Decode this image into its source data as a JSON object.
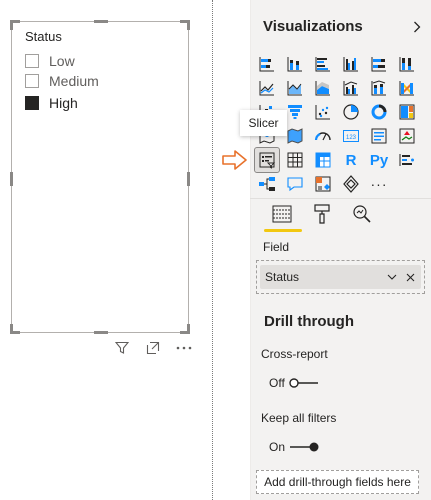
{
  "slicer": {
    "title": "Status",
    "options": [
      {
        "label": "Low",
        "checked": false
      },
      {
        "label": "Medium",
        "checked": false
      },
      {
        "label": "High",
        "checked": true
      }
    ],
    "toolbar_icons": [
      "filter-icon",
      "focus-mode-icon",
      "more-options-icon"
    ]
  },
  "visualizations": {
    "title": "Visualizations",
    "collapse_icon": "chevron-right-icon",
    "tooltip": "Slicer",
    "selected_visual": "slicer",
    "gallery_rows": [
      [
        "stacked-bar-icon",
        "stacked-column-icon",
        "clustered-bar-icon",
        "clustered-column-icon",
        "100-stacked-bar-icon",
        "100-stacked-column-icon"
      ],
      [
        "line-chart-icon",
        "area-chart-icon",
        "stacked-area-icon",
        "line-clustered-column-icon",
        "line-stacked-column-icon",
        "ribbon-chart-icon"
      ],
      [
        "waterfall-icon",
        "funnel-icon",
        "scatter-icon",
        "pie-chart-icon",
        "donut-chart-icon",
        "treemap-icon"
      ],
      [
        "map-icon",
        "filled-map-icon",
        "gauge-icon",
        "card-icon",
        "multi-row-card-icon",
        "kpi-icon"
      ],
      [
        "slicer-icon",
        "table-icon",
        "matrix-icon",
        "r-visual-icon",
        "python-visual-icon",
        "key-influencers-icon"
      ],
      [
        "decomposition-tree-icon",
        "qa-icon",
        "smart-narrative-icon",
        "power-apps-icon",
        "more-visuals-icon"
      ]
    ],
    "r_label": "R",
    "py_label": "Py",
    "more_label": "···",
    "tabs": [
      "fields-tab-icon",
      "format-tab-icon",
      "analytics-tab-icon"
    ],
    "active_tab": "fields",
    "field_label": "Field",
    "field_value": "Status",
    "drill_through": {
      "title": "Drill through",
      "cross_report_label": "Cross-report",
      "cross_report_state": "Off",
      "keep_filters_label": "Keep all filters",
      "keep_filters_state": "On",
      "add_fields_label": "Add drill-through fields here"
    }
  },
  "colors": {
    "accent_yellow": "#f2c811",
    "pointer_orange": "#e8722c",
    "icon_blue": "#118dff",
    "icon_dark": "#252423"
  }
}
